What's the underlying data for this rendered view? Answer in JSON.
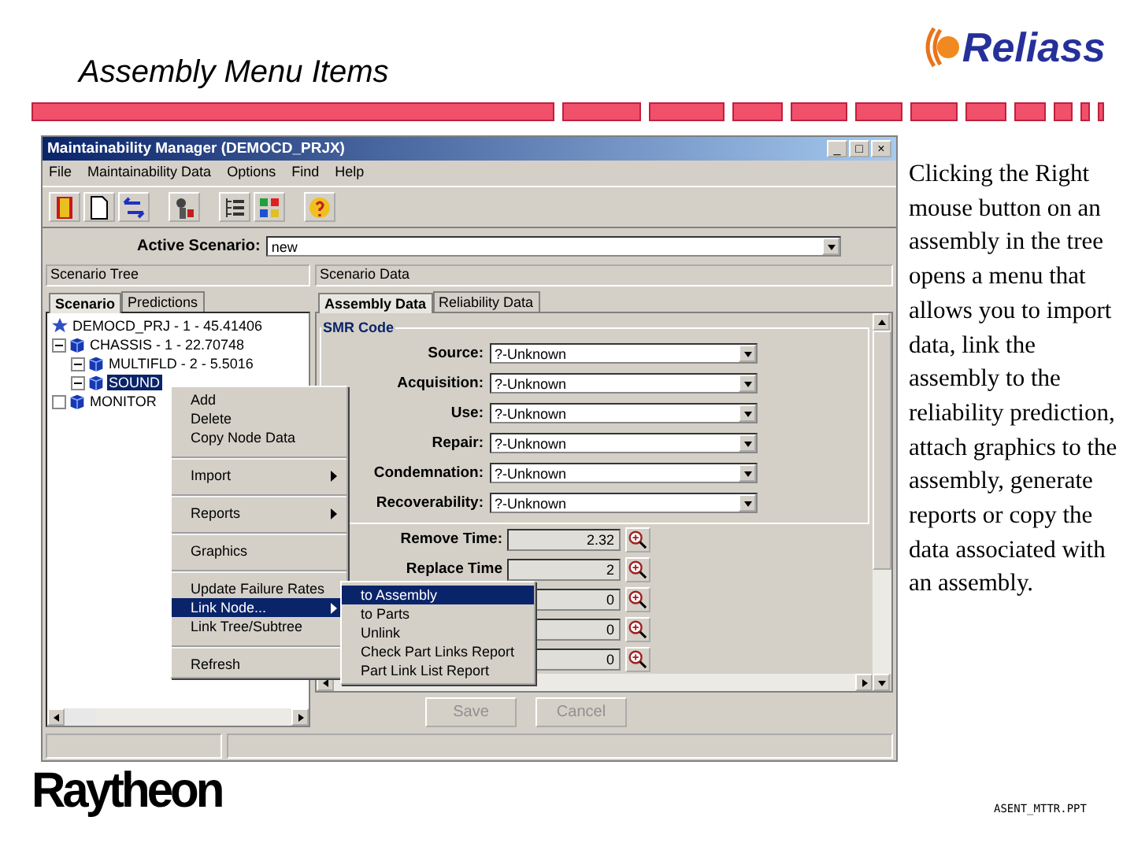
{
  "slide": {
    "title": "Assembly Menu Items",
    "logo": "Reliass",
    "body": "Clicking the Right mouse button on an assembly in the tree opens a menu that allows you to import data, link the assembly to the reliability prediction, attach graphics to the assembly, generate reports or copy the data associated with an assembly.",
    "company": "Raytheon",
    "footer": "ASENT_MTTR.PPT"
  },
  "window": {
    "title": "Maintainability Manager (DEMOCD_PRJX)",
    "controls": [
      "_",
      "□",
      "×"
    ]
  },
  "menu_bar": [
    "File",
    "Maintainability Data",
    "Options",
    "Find",
    "Help"
  ],
  "active_scenario": {
    "label": "Active Scenario:",
    "value": "new"
  },
  "left_pane": {
    "title": "Scenario Tree",
    "tabs": [
      {
        "label": "Scenario",
        "selected": true
      },
      {
        "label": "Predictions",
        "selected": false
      }
    ],
    "tree": [
      {
        "label": "DEMOCD_PRJ - 1 - 45.41406",
        "children": [
          {
            "label": "CHASSIS - 1 - 22.70748",
            "expanded": true,
            "selected": false,
            "children": [
              {
                "label": "MULTIFLD - 2 - 5.5016",
                "expanded": true,
                "selected": false
              },
              {
                "label": "SOUND",
                "expanded": true,
                "selected": true
              }
            ]
          },
          {
            "label": "MONITOR",
            "expanded": false,
            "selected": false
          }
        ]
      }
    ]
  },
  "right_pane": {
    "title": "Scenario Data",
    "tabs": [
      {
        "label": "Assembly Data",
        "selected": true
      },
      {
        "label": "Reliability Data",
        "selected": false
      }
    ],
    "group": "SMR Code",
    "codes": [
      {
        "label": "Source:",
        "value": "?-Unknown"
      },
      {
        "label": "Acquisition:",
        "value": "?-Unknown"
      },
      {
        "label": "Use:",
        "value": "?-Unknown"
      },
      {
        "label": "Repair:",
        "value": "?-Unknown"
      },
      {
        "label": "Condemnation:",
        "value": "?-Unknown"
      },
      {
        "label": "Recoverability:",
        "value": "?-Unknown"
      }
    ],
    "times": [
      {
        "label": "Remove Time:",
        "value": "2.32"
      },
      {
        "label": "Replace Time",
        "value": "2"
      },
      {
        "value": "0"
      },
      {
        "value": "0"
      },
      {
        "value": "0"
      }
    ],
    "buttons": [
      {
        "label": "Save",
        "disabled": true
      },
      {
        "label": "Cancel",
        "disabled": true
      }
    ]
  },
  "context_menu": [
    {
      "label": "Add",
      "submenu": false,
      "selected": false,
      "separator_after": false
    },
    {
      "label": "Delete",
      "submenu": false,
      "selected": false,
      "separator_after": false
    },
    {
      "label": "Copy Node Data",
      "submenu": false,
      "selected": false,
      "separator_after": true
    },
    {
      "label": "Import",
      "submenu": true,
      "selected": false,
      "separator_after": true
    },
    {
      "label": "Reports",
      "submenu": true,
      "selected": false,
      "separator_after": true
    },
    {
      "label": "Graphics",
      "submenu": false,
      "selected": false,
      "separator_after": true
    },
    {
      "label": "Update Failure Rates",
      "submenu": false,
      "selected": false,
      "separator_after": false
    },
    {
      "label": "Link Node...",
      "submenu": true,
      "selected": true,
      "separator_after": false
    },
    {
      "label": "Link Tree/Subtree",
      "submenu": false,
      "selected": false,
      "separator_after": true
    },
    {
      "label": "Refresh",
      "submenu": false,
      "selected": false,
      "separator_after": false
    }
  ],
  "submenu": [
    {
      "label": "to Assembly",
      "selected": true
    },
    {
      "label": "to Parts",
      "selected": false
    },
    {
      "label": "Unlink",
      "selected": false
    },
    {
      "label": "Check Part Links Report",
      "selected": false
    },
    {
      "label": "Part Link List Report",
      "selected": false
    }
  ]
}
